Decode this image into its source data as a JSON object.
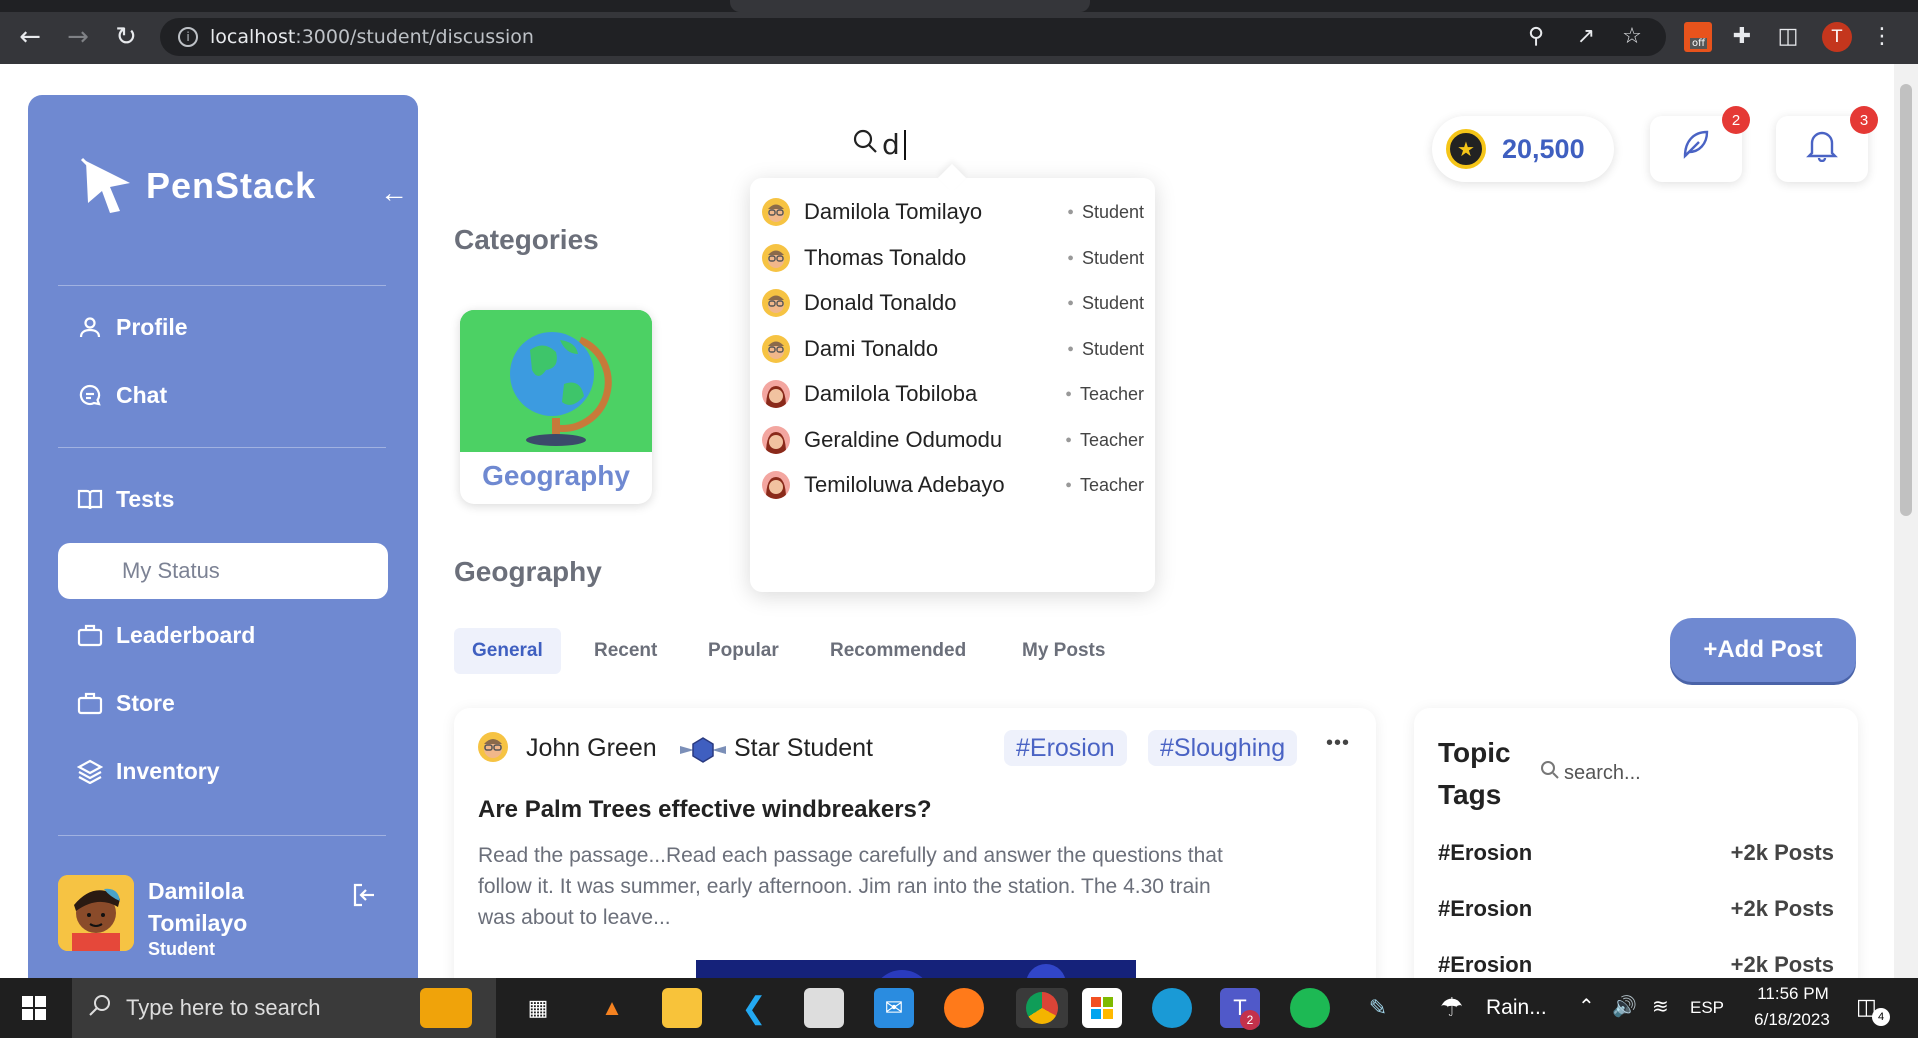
{
  "browser": {
    "url_host": "localhost",
    "url_path": ":3000/student/discussion",
    "profile_initial": "T",
    "pdf_ext_label": "off"
  },
  "sidebar": {
    "logo_text": "PenStack",
    "items": [
      {
        "label": "Profile",
        "icon": "user-icon"
      },
      {
        "label": "Chat",
        "icon": "chat-icon"
      },
      {
        "label": "Tests",
        "icon": "book-icon"
      },
      {
        "label": "My Status",
        "icon": "",
        "selected": true
      },
      {
        "label": "Leaderboard",
        "icon": "briefcase-icon"
      },
      {
        "label": "Store",
        "icon": "briefcase-icon"
      },
      {
        "label": "Inventory",
        "icon": "layers-icon"
      }
    ],
    "user": {
      "name_line1": "Damilola",
      "name_line2": "Tomilayo",
      "role": "Student"
    }
  },
  "search": {
    "value": "d"
  },
  "dropdown": {
    "results": [
      {
        "name": "Damilola Tomilayo",
        "role": "Student"
      },
      {
        "name": "Thomas Tonaldo",
        "role": "Student"
      },
      {
        "name": "Donald Tonaldo",
        "role": "Student"
      },
      {
        "name": "Dami Tonaldo",
        "role": "Student"
      },
      {
        "name": "Damilola Tobiloba",
        "role": "Teacher"
      },
      {
        "name": "Geraldine Odumodu",
        "role": "Teacher"
      },
      {
        "name": "Temiloluwa Adebayo",
        "role": "Teacher"
      }
    ]
  },
  "header": {
    "coins": "20,500",
    "feather_badge": "2",
    "bell_badge": "3"
  },
  "main": {
    "categories_title": "Categories",
    "category_card": "Geography",
    "section_title": "Geography",
    "tabs": [
      "General",
      "Recent",
      "Popular",
      "Recommended",
      "My Posts"
    ],
    "add_post": "+Add Post"
  },
  "post": {
    "author": "John Green",
    "badge": "Star Student",
    "tags": [
      "#Erosion",
      "#Sloughing"
    ],
    "more": "•••",
    "title": "Are Palm Trees effective windbreakers?",
    "body_line1": "Read the passage...Read each passage carefully and answer the questions that",
    "body_line2": "follow it. It was summer, early afternoon. Jim ran into the station. The 4.30 train",
    "body_line3": "was about to leave..."
  },
  "topic_tags": {
    "title_line1": "Topic",
    "title_line2": "Tags",
    "search_placeholder": "search...",
    "rows": [
      {
        "tag": "#Erosion",
        "count": "+2k Posts"
      },
      {
        "tag": "#Erosion",
        "count": "+2k Posts"
      },
      {
        "tag": "#Erosion",
        "count": "+2k Posts"
      }
    ]
  },
  "taskbar": {
    "search_placeholder": "Type here to search",
    "weather": "Rain...",
    "lang": "ESP",
    "time": "11:56 PM",
    "date": "6/18/2023",
    "teams_badge": "2",
    "notif_badge": "4"
  },
  "colors": {
    "sidebar": "#6f89d1",
    "accent": "#3f5fc0",
    "badge": "#e53935"
  }
}
